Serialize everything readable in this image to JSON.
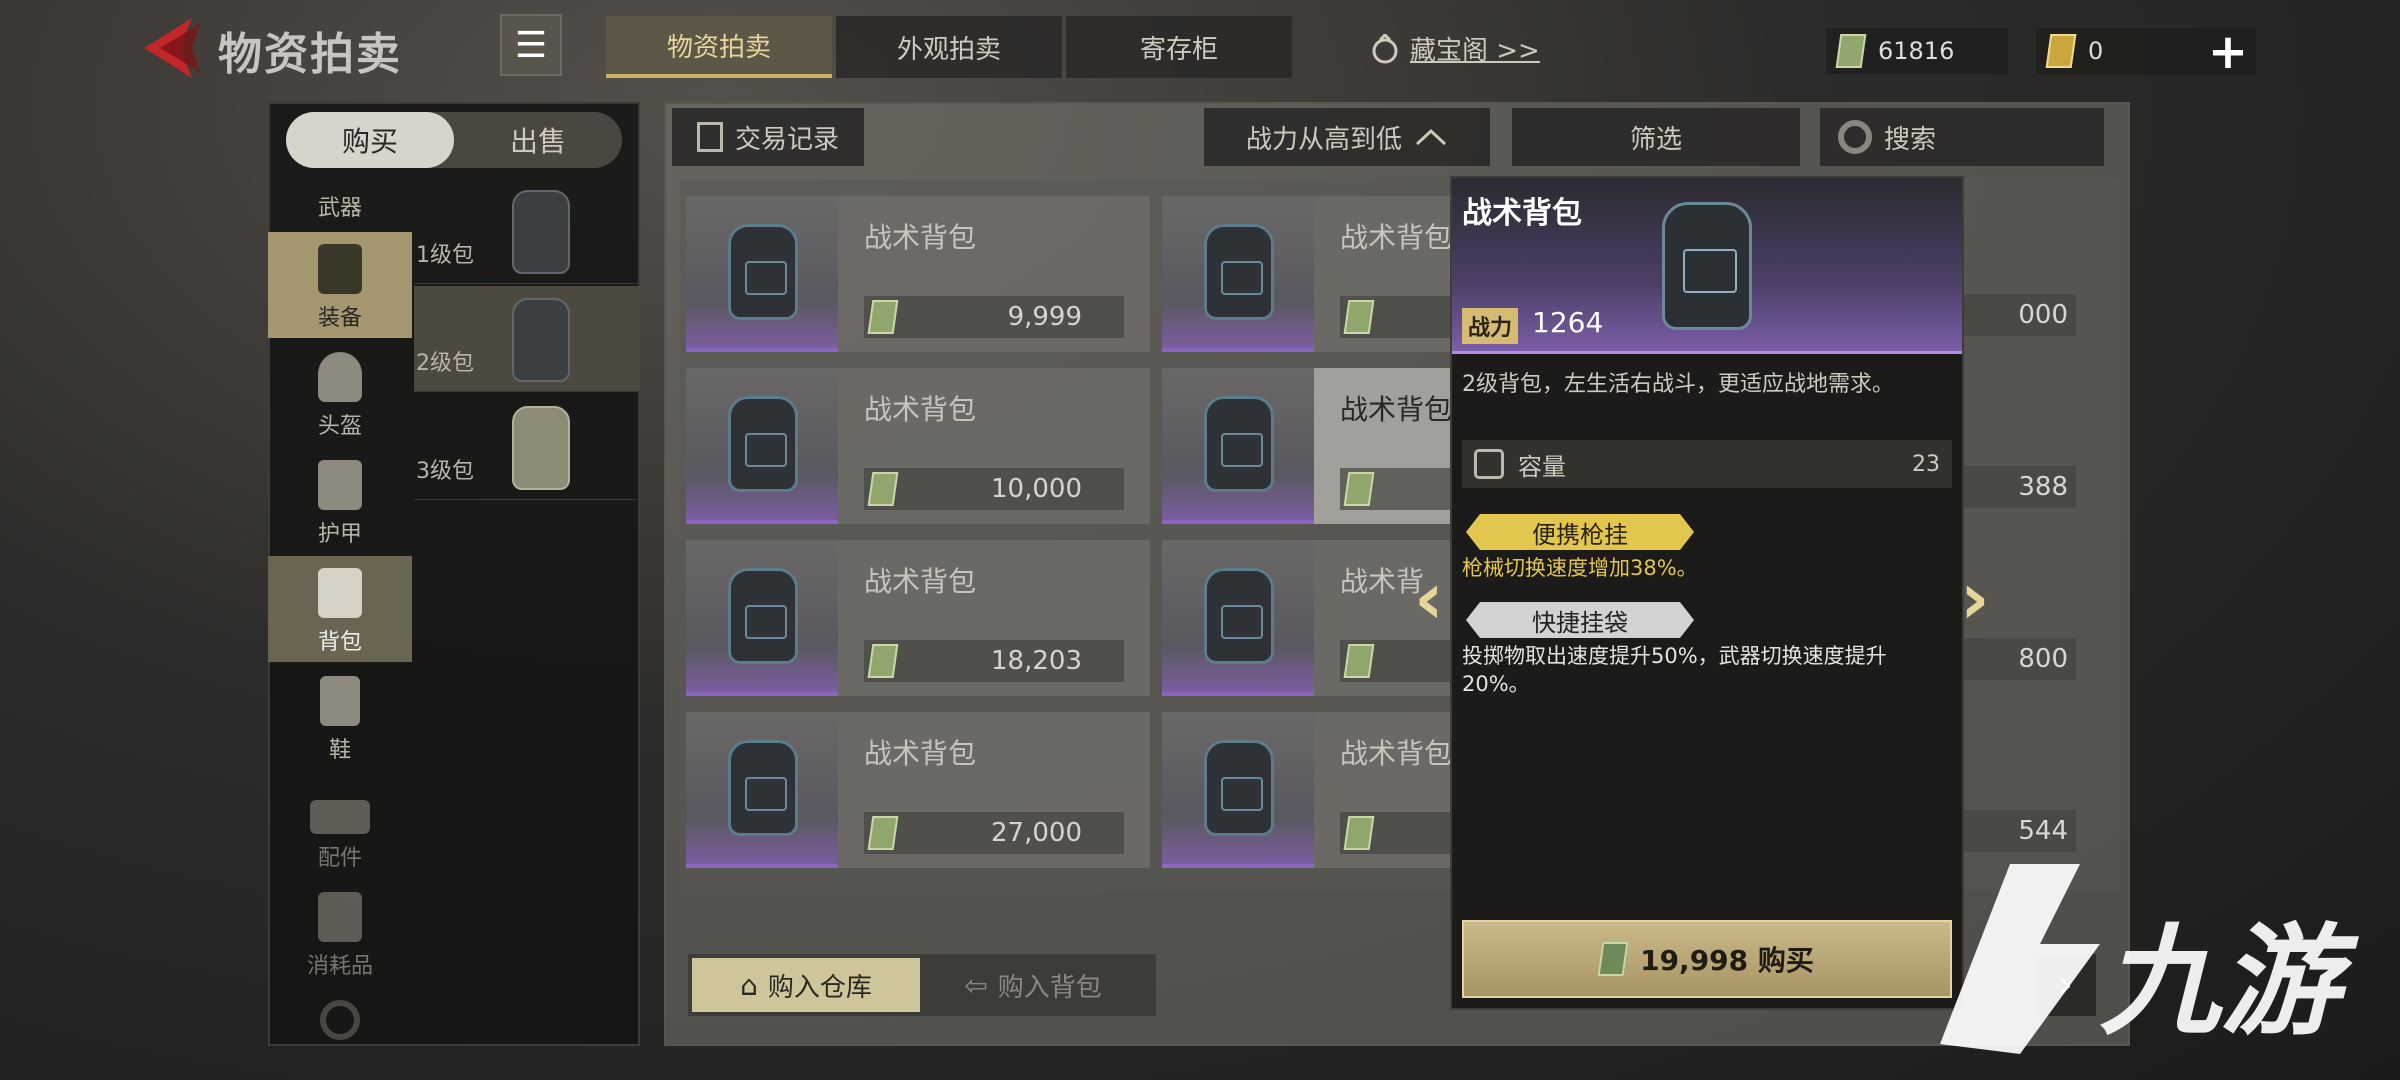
{
  "header": {
    "title": "物资拍卖",
    "tabs": [
      {
        "label": "物资拍卖",
        "active": true
      },
      {
        "label": "外观拍卖",
        "active": false
      },
      {
        "label": "寄存柜",
        "active": false
      }
    ],
    "treasure_link": "藏宝阁 >>",
    "cash_amount": "61816",
    "gold_amount": "0"
  },
  "left": {
    "toggle": {
      "buy": "购买",
      "sell": "出售"
    },
    "categories": [
      {
        "label": "武器",
        "icon": "weapon-icon"
      },
      {
        "label": "装备",
        "icon": "vest-icon"
      },
      {
        "label": "头盔",
        "icon": "helmet-icon"
      },
      {
        "label": "护甲",
        "icon": "armor-icon"
      },
      {
        "label": "背包",
        "icon": "backpack-icon"
      },
      {
        "label": "鞋",
        "icon": "boot-icon"
      },
      {
        "label": "配件",
        "icon": "attachment-icon"
      },
      {
        "label": "消耗品",
        "icon": "consumable-icon"
      }
    ],
    "subcategories": [
      {
        "label": "1级包"
      },
      {
        "label": "2级包"
      },
      {
        "label": "3级包"
      }
    ]
  },
  "toolbar": {
    "trade_record": "交易记录",
    "sort": "战力从高到低",
    "filter": "筛选",
    "search": "搜索"
  },
  "listings": [
    {
      "name": "战术背包",
      "price": "9,999"
    },
    {
      "name": "战术背包",
      "price": ""
    },
    {
      "name": "战术背包",
      "price": "10,000"
    },
    {
      "name": "战术背包",
      "price": ""
    },
    {
      "name": "战术背包",
      "price": "18,203"
    },
    {
      "name": "战术背",
      "price": ""
    },
    {
      "name": "战术背包",
      "price": "27,000"
    },
    {
      "name": "战术背包",
      "price": ""
    }
  ],
  "right_partial_prices": [
    "000",
    "388",
    "800",
    "544"
  ],
  "bottom": {
    "to_warehouse": "购入仓库",
    "to_backpack": "购入背包"
  },
  "detail": {
    "name": "战术背包",
    "power_label": "战力",
    "power_value": "1264",
    "description": "2级背包，左生活右战斗，更适应战地需求。",
    "capacity_label": "容量",
    "capacity_value": "23",
    "perk1_name": "便携枪挂",
    "perk1_desc": "枪械切换速度增加38%。",
    "perk2_name": "快捷挂袋",
    "perk2_desc": "投掷物取出速度提升50%，武器切换速度提升20%。",
    "buy_label": "19,998 购买"
  },
  "watermark": "九游",
  "colors": {
    "accent_gold": "#c9b26a",
    "rarity_purple": "#8a66c0",
    "perk_gold": "#e3c64d"
  }
}
